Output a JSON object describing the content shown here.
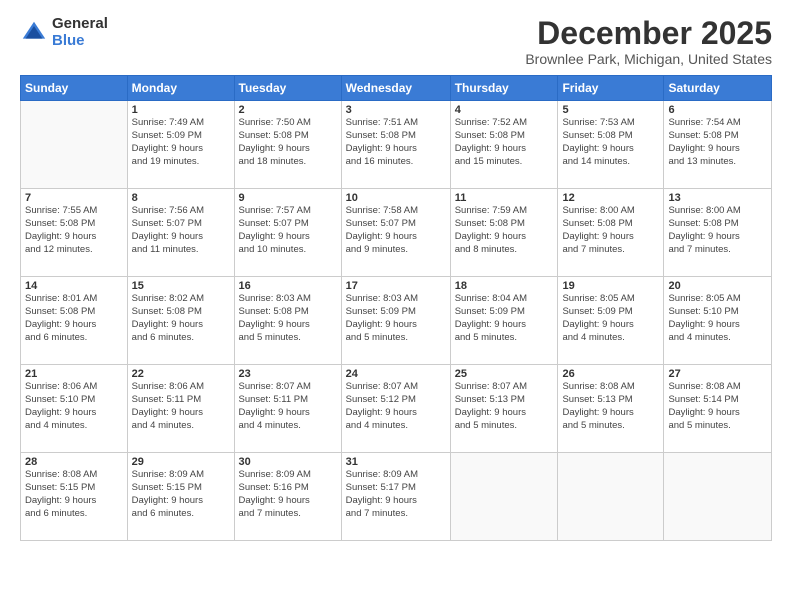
{
  "logo": {
    "general": "General",
    "blue": "Blue"
  },
  "header": {
    "title": "December 2025",
    "subtitle": "Brownlee Park, Michigan, United States"
  },
  "weekdays": [
    "Sunday",
    "Monday",
    "Tuesday",
    "Wednesday",
    "Thursday",
    "Friday",
    "Saturday"
  ],
  "weeks": [
    [
      {
        "day": "",
        "info": ""
      },
      {
        "day": "1",
        "info": "Sunrise: 7:49 AM\nSunset: 5:09 PM\nDaylight: 9 hours\nand 19 minutes."
      },
      {
        "day": "2",
        "info": "Sunrise: 7:50 AM\nSunset: 5:08 PM\nDaylight: 9 hours\nand 18 minutes."
      },
      {
        "day": "3",
        "info": "Sunrise: 7:51 AM\nSunset: 5:08 PM\nDaylight: 9 hours\nand 16 minutes."
      },
      {
        "day": "4",
        "info": "Sunrise: 7:52 AM\nSunset: 5:08 PM\nDaylight: 9 hours\nand 15 minutes."
      },
      {
        "day": "5",
        "info": "Sunrise: 7:53 AM\nSunset: 5:08 PM\nDaylight: 9 hours\nand 14 minutes."
      },
      {
        "day": "6",
        "info": "Sunrise: 7:54 AM\nSunset: 5:08 PM\nDaylight: 9 hours\nand 13 minutes."
      }
    ],
    [
      {
        "day": "7",
        "info": "Sunrise: 7:55 AM\nSunset: 5:08 PM\nDaylight: 9 hours\nand 12 minutes."
      },
      {
        "day": "8",
        "info": "Sunrise: 7:56 AM\nSunset: 5:07 PM\nDaylight: 9 hours\nand 11 minutes."
      },
      {
        "day": "9",
        "info": "Sunrise: 7:57 AM\nSunset: 5:07 PM\nDaylight: 9 hours\nand 10 minutes."
      },
      {
        "day": "10",
        "info": "Sunrise: 7:58 AM\nSunset: 5:07 PM\nDaylight: 9 hours\nand 9 minutes."
      },
      {
        "day": "11",
        "info": "Sunrise: 7:59 AM\nSunset: 5:08 PM\nDaylight: 9 hours\nand 8 minutes."
      },
      {
        "day": "12",
        "info": "Sunrise: 8:00 AM\nSunset: 5:08 PM\nDaylight: 9 hours\nand 7 minutes."
      },
      {
        "day": "13",
        "info": "Sunrise: 8:00 AM\nSunset: 5:08 PM\nDaylight: 9 hours\nand 7 minutes."
      }
    ],
    [
      {
        "day": "14",
        "info": "Sunrise: 8:01 AM\nSunset: 5:08 PM\nDaylight: 9 hours\nand 6 minutes."
      },
      {
        "day": "15",
        "info": "Sunrise: 8:02 AM\nSunset: 5:08 PM\nDaylight: 9 hours\nand 6 minutes."
      },
      {
        "day": "16",
        "info": "Sunrise: 8:03 AM\nSunset: 5:08 PM\nDaylight: 9 hours\nand 5 minutes."
      },
      {
        "day": "17",
        "info": "Sunrise: 8:03 AM\nSunset: 5:09 PM\nDaylight: 9 hours\nand 5 minutes."
      },
      {
        "day": "18",
        "info": "Sunrise: 8:04 AM\nSunset: 5:09 PM\nDaylight: 9 hours\nand 5 minutes."
      },
      {
        "day": "19",
        "info": "Sunrise: 8:05 AM\nSunset: 5:09 PM\nDaylight: 9 hours\nand 4 minutes."
      },
      {
        "day": "20",
        "info": "Sunrise: 8:05 AM\nSunset: 5:10 PM\nDaylight: 9 hours\nand 4 minutes."
      }
    ],
    [
      {
        "day": "21",
        "info": "Sunrise: 8:06 AM\nSunset: 5:10 PM\nDaylight: 9 hours\nand 4 minutes."
      },
      {
        "day": "22",
        "info": "Sunrise: 8:06 AM\nSunset: 5:11 PM\nDaylight: 9 hours\nand 4 minutes."
      },
      {
        "day": "23",
        "info": "Sunrise: 8:07 AM\nSunset: 5:11 PM\nDaylight: 9 hours\nand 4 minutes."
      },
      {
        "day": "24",
        "info": "Sunrise: 8:07 AM\nSunset: 5:12 PM\nDaylight: 9 hours\nand 4 minutes."
      },
      {
        "day": "25",
        "info": "Sunrise: 8:07 AM\nSunset: 5:13 PM\nDaylight: 9 hours\nand 5 minutes."
      },
      {
        "day": "26",
        "info": "Sunrise: 8:08 AM\nSunset: 5:13 PM\nDaylight: 9 hours\nand 5 minutes."
      },
      {
        "day": "27",
        "info": "Sunrise: 8:08 AM\nSunset: 5:14 PM\nDaylight: 9 hours\nand 5 minutes."
      }
    ],
    [
      {
        "day": "28",
        "info": "Sunrise: 8:08 AM\nSunset: 5:15 PM\nDaylight: 9 hours\nand 6 minutes."
      },
      {
        "day": "29",
        "info": "Sunrise: 8:09 AM\nSunset: 5:15 PM\nDaylight: 9 hours\nand 6 minutes."
      },
      {
        "day": "30",
        "info": "Sunrise: 8:09 AM\nSunset: 5:16 PM\nDaylight: 9 hours\nand 7 minutes."
      },
      {
        "day": "31",
        "info": "Sunrise: 8:09 AM\nSunset: 5:17 PM\nDaylight: 9 hours\nand 7 minutes."
      },
      {
        "day": "",
        "info": ""
      },
      {
        "day": "",
        "info": ""
      },
      {
        "day": "",
        "info": ""
      }
    ]
  ]
}
